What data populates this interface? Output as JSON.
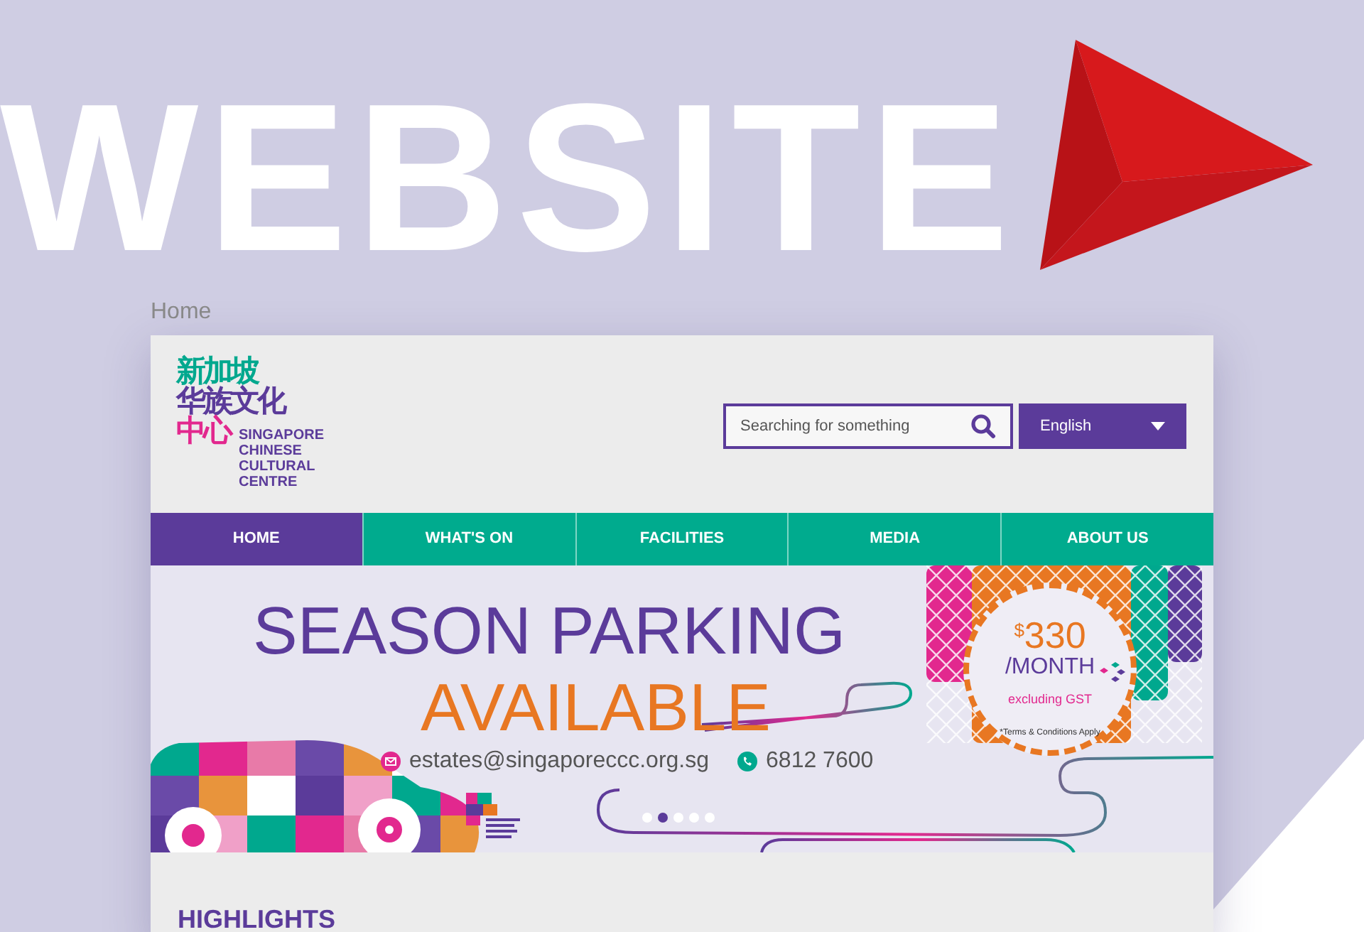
{
  "backdrop": {
    "headline": "WEBSITE",
    "page_label": "Home"
  },
  "header": {
    "logo": {
      "chinese_lines": [
        "新加坡",
        "华族文化",
        "中心"
      ],
      "english_lines": [
        "SINGAPORE",
        "CHINESE",
        "CULTURAL",
        "CENTRE"
      ]
    },
    "search": {
      "placeholder": "Searching for something"
    },
    "language": {
      "value": "English"
    }
  },
  "nav": [
    {
      "label": "HOME",
      "selected": true
    },
    {
      "label": "WHAT'S ON",
      "selected": false
    },
    {
      "label": "FACILITIES",
      "selected": false
    },
    {
      "label": "MEDIA",
      "selected": false
    },
    {
      "label": "ABOUT US",
      "selected": false
    }
  ],
  "banner": {
    "title_line_1": "SEASON PARKING",
    "title_line_2": "AVAILABLE",
    "email": "estates@singaporeccc.org.sg",
    "phone": "6812 7600",
    "price": {
      "currency": "$",
      "amount": "330",
      "period": "/MONTH",
      "note": "excluding GST",
      "terms": "*Terms & Conditions Apply"
    },
    "slides": [
      {
        "selected": false
      },
      {
        "selected": true
      },
      {
        "selected": false
      },
      {
        "selected": false
      },
      {
        "selected": false
      }
    ]
  },
  "highlights": {
    "title": "HIGHLIGHTS"
  }
}
